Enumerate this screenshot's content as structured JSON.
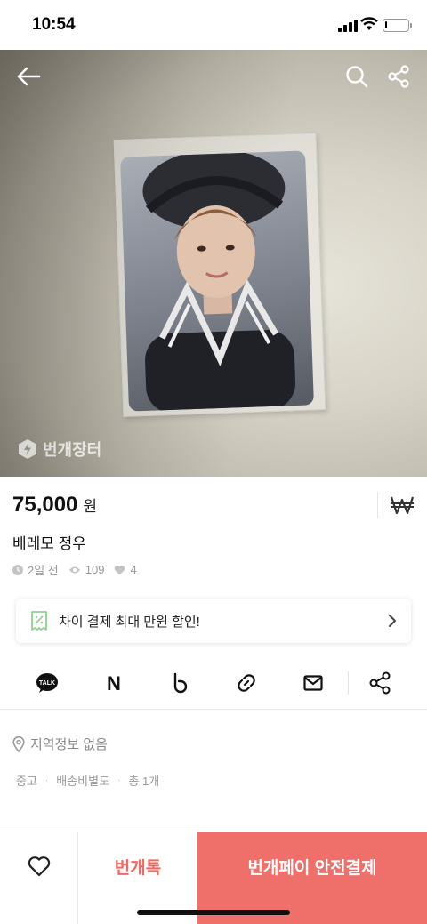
{
  "status_bar": {
    "time": "10:54",
    "battery_level": 0.1
  },
  "header": {
    "back_icon": "arrow-left-icon",
    "search_icon": "search-icon",
    "share_icon": "share-icon",
    "watermark": "번개장터"
  },
  "product": {
    "price": "75,000",
    "price_unit": "원",
    "title": "베레모 정우",
    "posted": "2일 전",
    "views": "109",
    "likes": "4"
  },
  "promo": {
    "text": "차이 결제 최대 만원 할인!"
  },
  "share_options": [
    {
      "name": "kakao-talk-icon",
      "label": "TALK"
    },
    {
      "name": "naver-icon",
      "label": "N"
    },
    {
      "name": "band-icon"
    },
    {
      "name": "link-icon"
    },
    {
      "name": "mail-icon"
    },
    {
      "name": "share-icon"
    }
  ],
  "location": {
    "text": "지역정보 없음"
  },
  "tags": [
    "중고",
    "배송비별도",
    "총 1개"
  ],
  "bottom_bar": {
    "talk_label": "번개톡",
    "pay_label": "번개페이 안전결제"
  },
  "colors": {
    "accent": "#ef6f6b",
    "accent_text": "#f06a62",
    "promo_icon": "#8fd18f"
  }
}
